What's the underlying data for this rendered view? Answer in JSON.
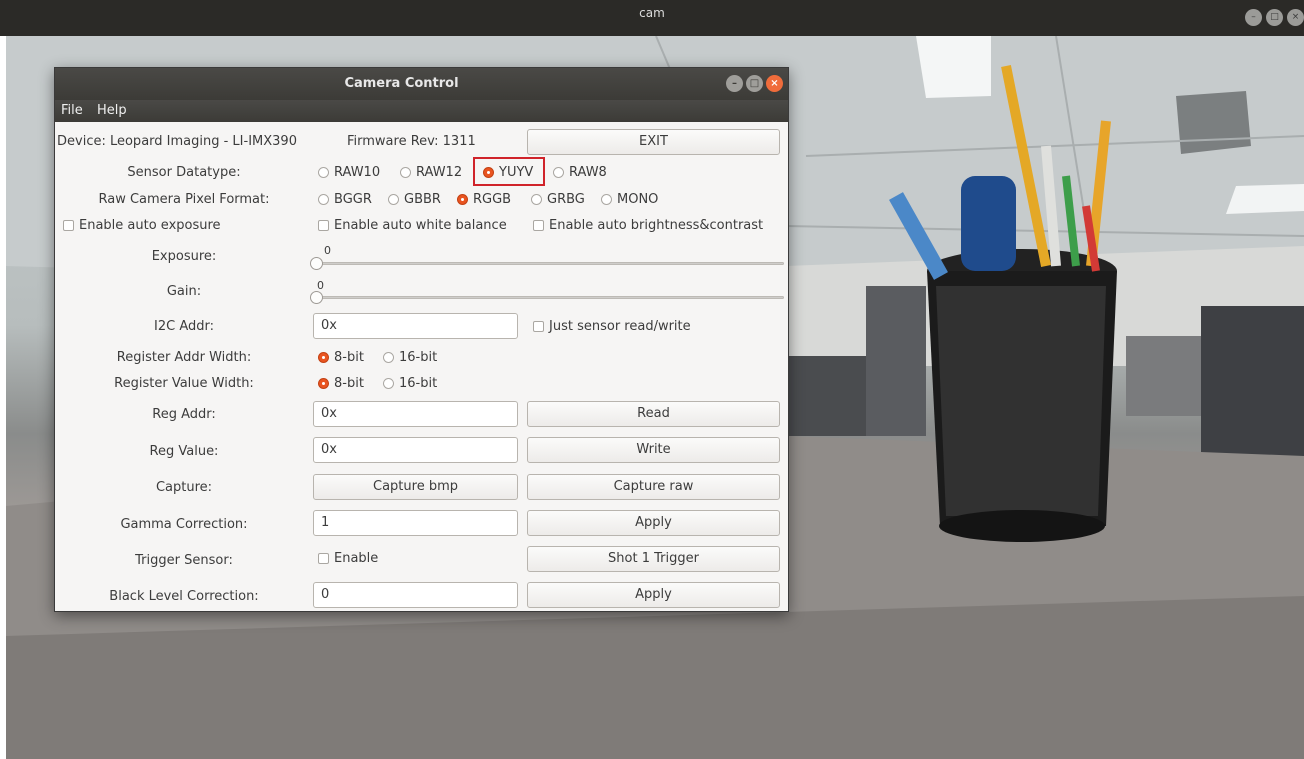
{
  "outer_window": {
    "title": "cam",
    "controls": [
      "minimize-icon",
      "maximize-icon",
      "close-icon"
    ]
  },
  "dialog": {
    "title": "Camera Control",
    "menu": [
      "File",
      "Help"
    ],
    "device": "Device: Leopard Imaging - LI-IMX390",
    "firmware": "Firmware Rev: 1311",
    "exit_label": "EXIT",
    "sensor_datatype": {
      "label": "Sensor Datatype:",
      "options": [
        "RAW10",
        "RAW12",
        "YUYV",
        "RAW8"
      ],
      "selected": "YUYV"
    },
    "pixel_format": {
      "label": "Raw Camera Pixel Format:",
      "options": [
        "BGGR",
        "GBBR",
        "RGGB",
        "GRBG",
        "MONO"
      ],
      "selected": "RGGB"
    },
    "checks": {
      "auto_exposure": "Enable auto exposure",
      "auto_white_balance": "Enable auto white balance",
      "auto_brightness": "Enable auto brightness&contrast"
    },
    "exposure": {
      "label": "Exposure:",
      "value": "0"
    },
    "gain": {
      "label": "Gain:",
      "value": "0"
    },
    "i2c": {
      "label": "I2C Addr:",
      "value": "0x",
      "just_sensor": "Just sensor read/write"
    },
    "reg_addr_width": {
      "label": "Register Addr Width:",
      "options": [
        "8-bit",
        "16-bit"
      ],
      "selected": "8-bit"
    },
    "reg_value_width": {
      "label": "Register Value Width:",
      "options": [
        "8-bit",
        "16-bit"
      ],
      "selected": "8-bit"
    },
    "reg_addr": {
      "label": "Reg Addr:",
      "value": "0x",
      "button": "Read"
    },
    "reg_value": {
      "label": "Reg Value:",
      "value": "0x",
      "button": "Write"
    },
    "capture": {
      "label": "Capture:",
      "bmp": "Capture bmp",
      "raw": "Capture raw"
    },
    "gamma": {
      "label": "Gamma Correction:",
      "value": "1",
      "button": "Apply"
    },
    "trigger": {
      "label": "Trigger Sensor:",
      "enable": "Enable",
      "button": "Shot 1 Trigger"
    },
    "black_level": {
      "label": "Black Level Correction:",
      "value": "0",
      "button": "Apply"
    }
  },
  "colors": {
    "accent": "#e95420",
    "highlight": "#d0232a",
    "titlebar": "#3c3b37"
  }
}
